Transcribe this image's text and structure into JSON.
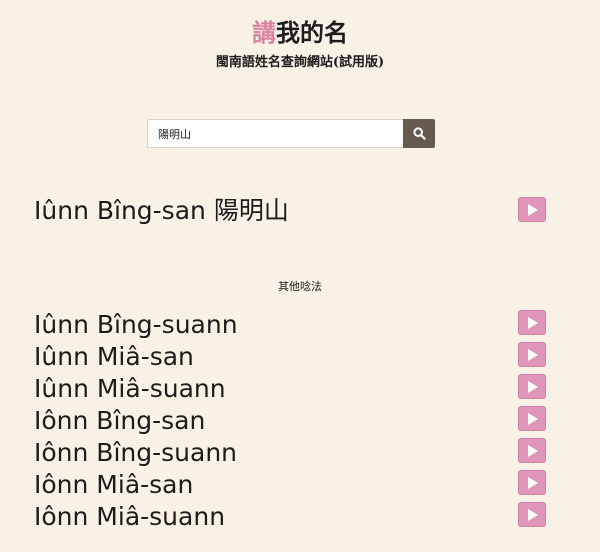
{
  "header": {
    "title_accent": "講",
    "title_rest": "我的名",
    "subtitle": "閩南語姓名查詢網站(試用版)"
  },
  "search": {
    "value": "陽明山",
    "button_icon": "search-icon"
  },
  "result": {
    "reading": "Iûnn Bîng-san 陽明山",
    "play_icon": "play-icon"
  },
  "other_label": "其他唸法",
  "alternatives": [
    "Iûnn Bîng-suann",
    "Iûnn Miâ-san",
    "Iûnn Miâ-suann",
    "Iônn Bîng-san",
    "Iônn Bîng-suann",
    "Iônn Miâ-san",
    "Iônn Miâ-suann"
  ],
  "colors": {
    "background": "#f8f1e5",
    "accent": "#d9879e",
    "play_button": "#df96b8",
    "search_button": "#665a4f"
  }
}
